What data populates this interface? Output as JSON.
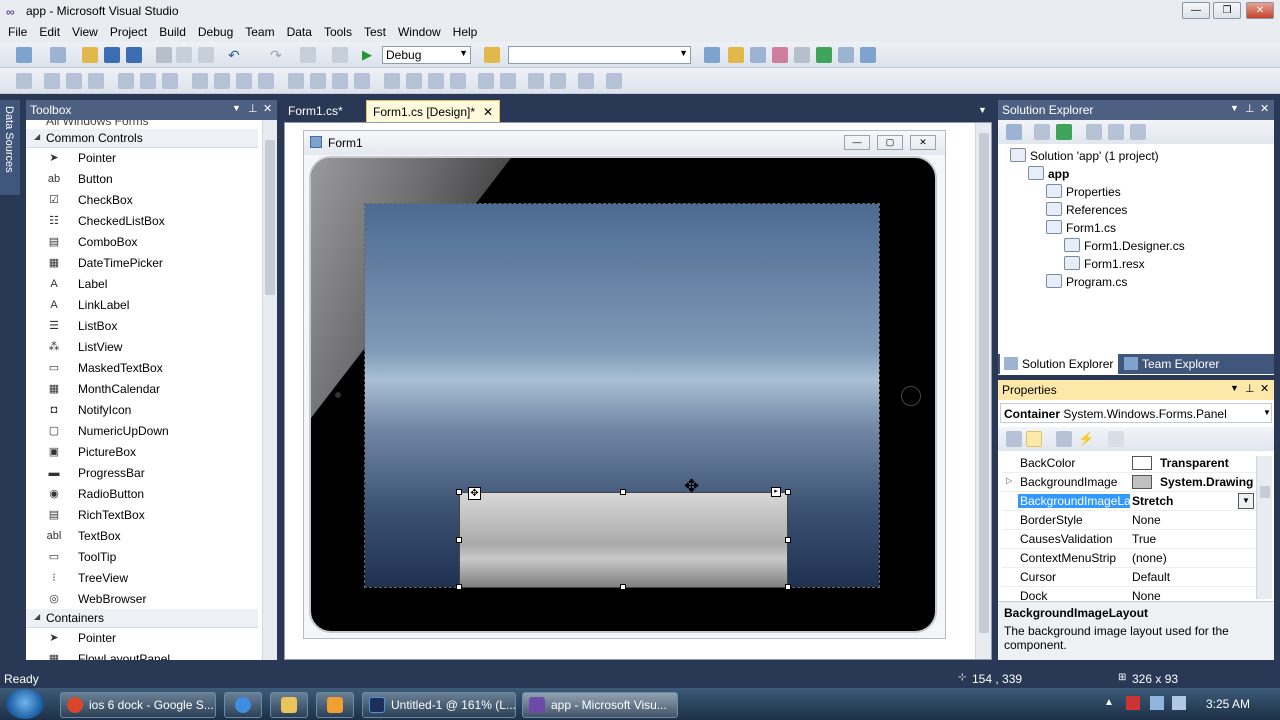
{
  "window": {
    "title": "app - Microsoft Visual Studio",
    "min": "—",
    "max": "❐",
    "close": "✕"
  },
  "menu": [
    "File",
    "Edit",
    "View",
    "Project",
    "Build",
    "Debug",
    "Team",
    "Data",
    "Tools",
    "Test",
    "Window",
    "Help"
  ],
  "toolbar": {
    "config": "Debug",
    "platform": ""
  },
  "side_tab": "Data Sources",
  "toolbox": {
    "title": "Toolbox",
    "scrolled_group": "All Windows Forms",
    "common": "Common Controls",
    "containers": "Containers",
    "items": [
      "Pointer",
      "Button",
      "CheckBox",
      "CheckedListBox",
      "ComboBox",
      "DateTimePicker",
      "Label",
      "LinkLabel",
      "ListBox",
      "ListView",
      "MaskedTextBox",
      "MonthCalendar",
      "NotifyIcon",
      "NumericUpDown",
      "PictureBox",
      "ProgressBar",
      "RadioButton",
      "RichTextBox",
      "TextBox",
      "ToolTip",
      "TreeView",
      "WebBrowser"
    ],
    "container_items": [
      "Pointer",
      "FlowLayoutPanel"
    ],
    "icons": [
      "➤",
      "ab",
      "☑",
      "☷",
      "▤",
      "▦",
      "A",
      "A",
      "☰",
      "⁂",
      "▭",
      "▦",
      "◘",
      "▢",
      "▣",
      "▬",
      "◉",
      "▤",
      "abl",
      "▭",
      "⁝",
      "◎"
    ]
  },
  "tabs": [
    {
      "label": "Form1.cs*",
      "active": false
    },
    {
      "label": "Form1.cs [Design]*",
      "active": true
    }
  ],
  "form": {
    "title": "Form1"
  },
  "solution_explorer": {
    "title": "Solution Explorer",
    "tree": [
      {
        "label": "Solution 'app' (1 project)",
        "indent": 0
      },
      {
        "label": "app",
        "indent": 1,
        "bold": true
      },
      {
        "label": "Properties",
        "indent": 2
      },
      {
        "label": "References",
        "indent": 2
      },
      {
        "label": "Form1.cs",
        "indent": 2
      },
      {
        "label": "Form1.Designer.cs",
        "indent": 3
      },
      {
        "label": "Form1.resx",
        "indent": 3
      },
      {
        "label": "Program.cs",
        "indent": 2
      }
    ],
    "tab_solution": "Solution Explorer",
    "tab_team": "Team Explorer"
  },
  "properties": {
    "title": "Properties",
    "object": "Container",
    "object_type": "System.Windows.Forms.Panel",
    "rows": [
      {
        "name": "BackColor",
        "value": "Transparent",
        "bold": true,
        "swatch": "#ffffff"
      },
      {
        "name": "BackgroundImage",
        "value": "System.Drawing.",
        "bold": true,
        "swatch": "#c0c0c0",
        "expand": true
      },
      {
        "name": "BackgroundImageLa",
        "value": "Stretch",
        "bold": true,
        "selected": true
      },
      {
        "name": "BorderStyle",
        "value": "None"
      },
      {
        "name": "CausesValidation",
        "value": "True"
      },
      {
        "name": "ContextMenuStrip",
        "value": "(none)"
      },
      {
        "name": "Cursor",
        "value": "Default"
      },
      {
        "name": "Dock",
        "value": "None"
      }
    ],
    "desc_title": "BackgroundImageLayout",
    "desc_text": "The background image layout used for the component."
  },
  "status": {
    "left": "Ready",
    "position": "154 , 339",
    "size": "326 x 93"
  },
  "taskbar": {
    "items": [
      "ios 6 dock - Google S...",
      "",
      "",
      "",
      "Untitled-1 @ 161% (L...",
      "app - Microsoft Visu..."
    ],
    "time": "3:25 AM"
  }
}
